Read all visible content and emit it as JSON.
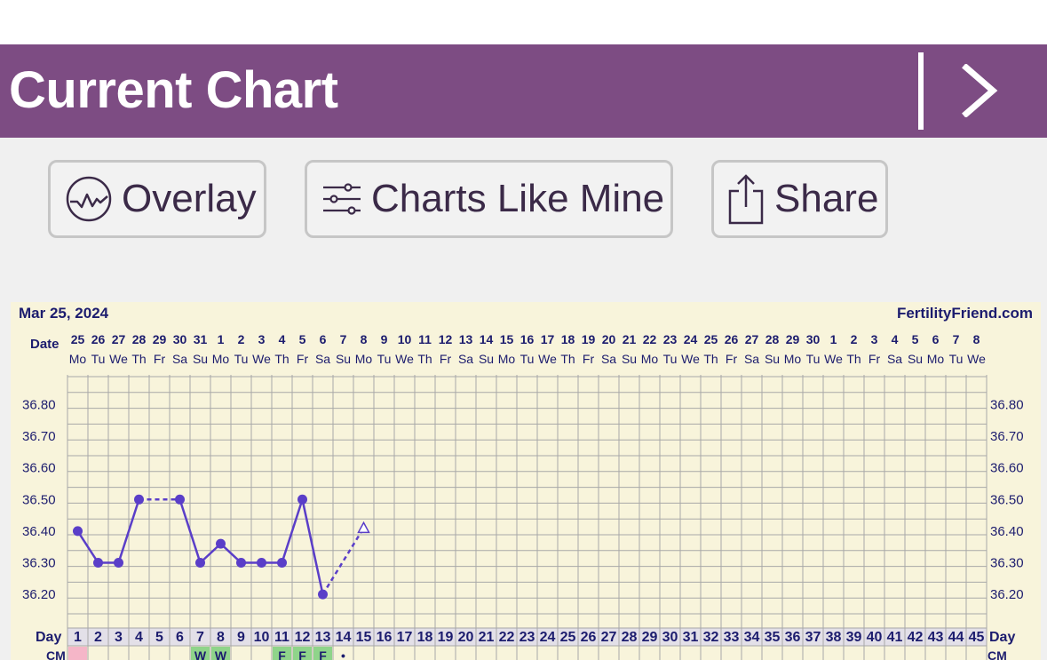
{
  "header": {
    "title": "Current Chart"
  },
  "toolbar": {
    "overlay_label": "Overlay",
    "charts_like_mine_label": "Charts Like Mine",
    "share_label": "Share"
  },
  "chart_meta": {
    "date_label": "Mar 25, 2024",
    "brand": "FertilityFriend.com",
    "date_row_label": "Date",
    "day_row_label": "Day",
    "cm_row_label": "CM",
    "dates": [
      "25",
      "26",
      "27",
      "28",
      "29",
      "30",
      "31",
      "1",
      "2",
      "3",
      "4",
      "5",
      "6",
      "7",
      "8",
      "9",
      "10",
      "11",
      "12",
      "13",
      "14",
      "15",
      "16",
      "17",
      "18",
      "19",
      "20",
      "21",
      "22",
      "23",
      "24",
      "25",
      "26",
      "27",
      "28",
      "29",
      "30",
      "1",
      "2",
      "3",
      "4",
      "5",
      "6",
      "7",
      "8"
    ],
    "weekdays": [
      "Mo",
      "Tu",
      "We",
      "Th",
      "Fr",
      "Sa",
      "Su",
      "Mo",
      "Tu",
      "We",
      "Th",
      "Fr",
      "Sa",
      "Su",
      "Mo",
      "Tu",
      "We",
      "Th",
      "Fr",
      "Sa",
      "Su",
      "Mo",
      "Tu",
      "We",
      "Th",
      "Fr",
      "Sa",
      "Su",
      "Mo",
      "Tu",
      "We",
      "Th",
      "Fr",
      "Sa",
      "Su",
      "Mo",
      "Tu",
      "We",
      "Th",
      "Fr",
      "Sa",
      "Su",
      "Mo",
      "Tu",
      "We"
    ],
    "cm_entries": [
      {
        "day": 1,
        "label": "",
        "color": "#f5b6c8"
      },
      {
        "day": 7,
        "label": "W",
        "color": "#8fd48a"
      },
      {
        "day": 8,
        "label": "W",
        "color": "#8fd48a"
      },
      {
        "day": 11,
        "label": "F",
        "color": "#8fd48a"
      },
      {
        "day": 12,
        "label": "F",
        "color": "#8fd48a"
      },
      {
        "day": 13,
        "label": "F",
        "color": "#8fd48a"
      },
      {
        "day": 14,
        "label": "•",
        "color": ""
      }
    ]
  },
  "chart_data": {
    "type": "line",
    "title": "",
    "xlabel": "Day",
    "ylabel": "",
    "x": [
      1,
      2,
      3,
      4,
      5,
      6,
      7,
      8,
      9,
      10,
      11,
      12,
      13
    ],
    "series": [
      {
        "values": [
          36.4,
          36.3,
          36.3,
          36.5,
          null,
          36.5,
          36.3,
          36.36,
          36.3,
          36.3,
          36.3,
          36.5,
          36.2
        ]
      }
    ],
    "interpolated": [
      {
        "from_day": 4,
        "to_day": 6
      }
    ],
    "projected_point": {
      "day": 15,
      "value": 36.41
    },
    "y_ticks": [
      "36.80",
      "36.70",
      "36.60",
      "36.50",
      "36.40",
      "36.30",
      "36.20"
    ],
    "ylim": [
      36.2,
      36.8
    ],
    "days_shown": 45,
    "grid": true,
    "colors": {
      "line": "#5a3ec8",
      "background": "#f8f4db",
      "grid": "#a8a8a8",
      "label": "#1c1c6e"
    }
  }
}
